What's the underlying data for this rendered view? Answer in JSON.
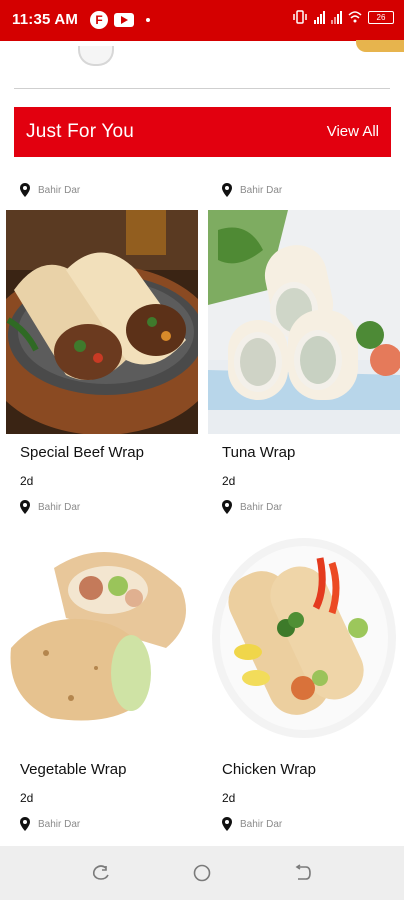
{
  "status_bar": {
    "time": "11:35 AM",
    "app_icon_letter": "F",
    "battery": "26"
  },
  "section": {
    "title": "Just For You",
    "view_all": "View All",
    "accent_color": "#e2000f"
  },
  "top_row_locations": [
    "Bahir Dar",
    "Bahir Dar"
  ],
  "products": [
    {
      "name": "Special Beef Wrap",
      "time": "2d",
      "location": "Bahir Dar",
      "image_icon": "beef-wrap-image"
    },
    {
      "name": "Tuna Wrap",
      "time": "2d",
      "location": "Bahir Dar",
      "image_icon": "tuna-wrap-image"
    },
    {
      "name": "Vegetable Wrap",
      "time": "2d",
      "location": "Bahir Dar",
      "image_icon": "vegetable-wrap-image"
    },
    {
      "name": "Chicken Wrap",
      "time": "2d",
      "location": "Bahir Dar",
      "image_icon": "chicken-wrap-image"
    }
  ],
  "nav": {
    "recent_icon": "recent-apps-icon",
    "home_icon": "home-icon",
    "back_icon": "back-icon"
  }
}
